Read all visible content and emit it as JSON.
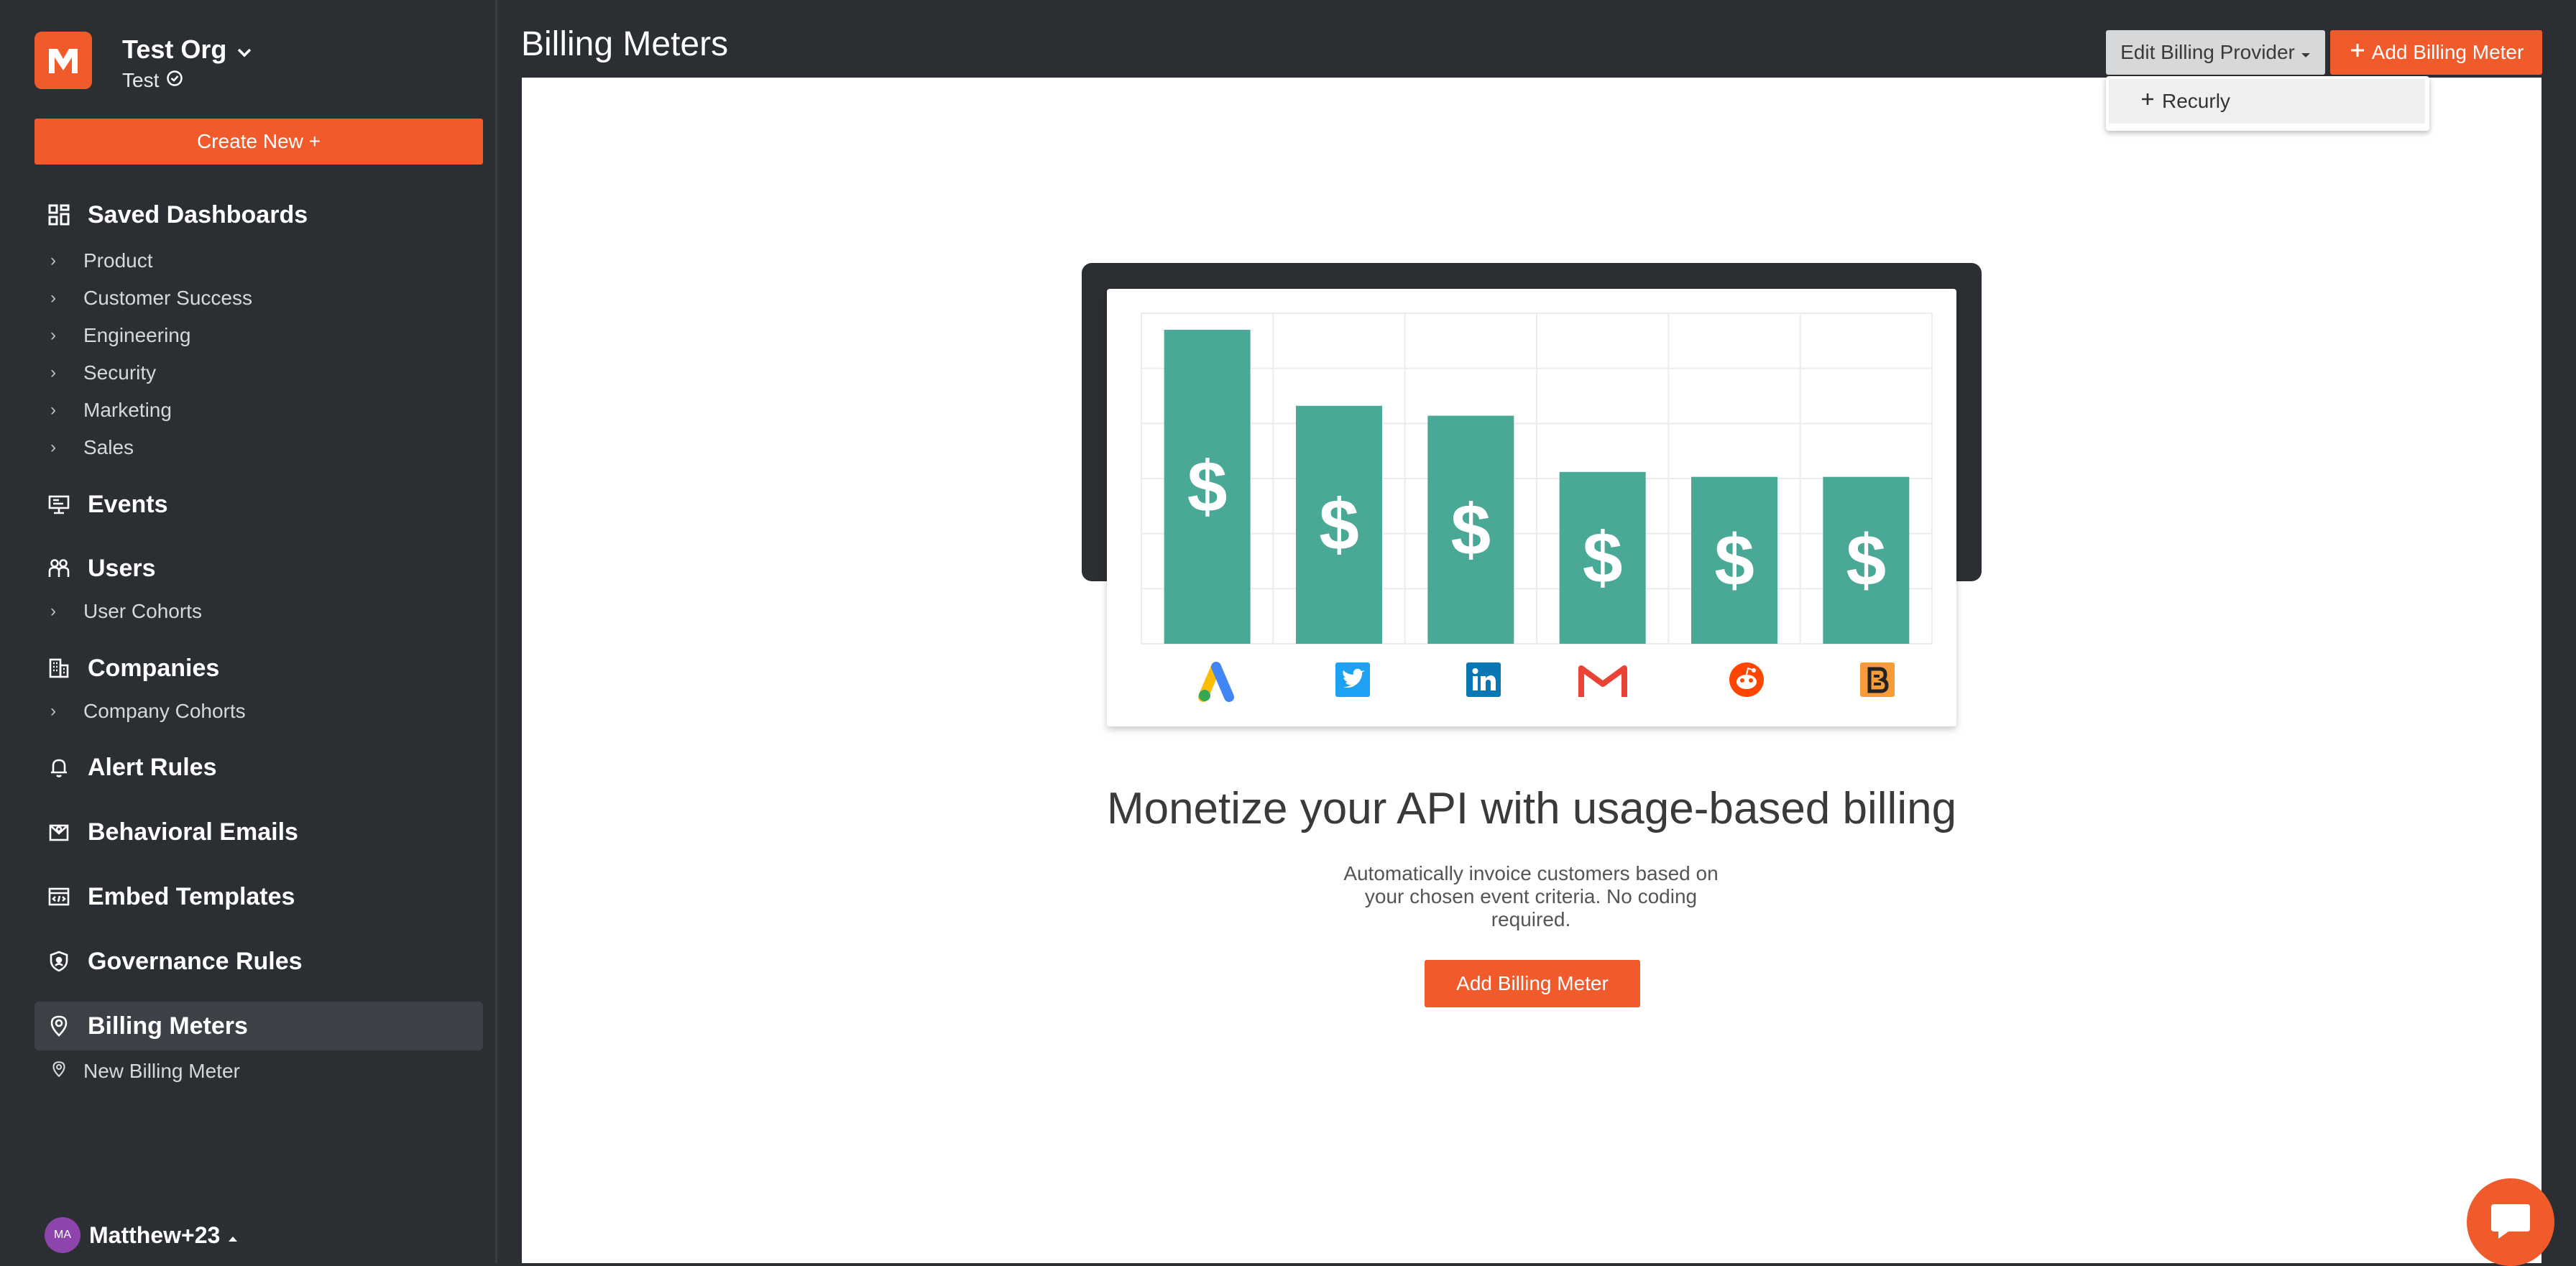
{
  "org": {
    "name": "Test Org",
    "env": "Test"
  },
  "sidebar": {
    "create_label": "Create New +",
    "saved_dashboards": {
      "label": "Saved Dashboards",
      "items": [
        "Product",
        "Customer Success",
        "Engineering",
        "Security",
        "Marketing",
        "Sales"
      ]
    },
    "events": {
      "label": "Events"
    },
    "users": {
      "label": "Users",
      "items": [
        "User Cohorts"
      ]
    },
    "companies": {
      "label": "Companies",
      "items": [
        "Company Cohorts"
      ]
    },
    "alert_rules": {
      "label": "Alert Rules"
    },
    "behavioral_emails": {
      "label": "Behavioral Emails"
    },
    "embed_templates": {
      "label": "Embed Templates"
    },
    "governance_rules": {
      "label": "Governance Rules"
    },
    "billing_meters": {
      "label": "Billing Meters",
      "items": [
        "New Billing Meter"
      ]
    },
    "user": {
      "initials": "MA",
      "name": "Matthew+23"
    }
  },
  "header": {
    "title": "Billing Meters",
    "edit_provider_label": "Edit Billing Provider",
    "add_meter_label": "Add Billing Meter"
  },
  "dropdown": {
    "items": [
      "Recurly"
    ]
  },
  "empty_state": {
    "headline": "Monetize your API with usage-based billing",
    "description": "Automatically invoice customers based on your chosen event criteria. No coding required.",
    "button_label": "Add Billing Meter",
    "bar_symbol": "$",
    "bar_levels": [
      0.95,
      0.72,
      0.69,
      0.52,
      0.505,
      0.505
    ],
    "logos": [
      "google-ads-icon",
      "twitter-icon",
      "linkedin-icon",
      "gmail-icon",
      "reddit-icon",
      "blogger-icon"
    ]
  },
  "colors": {
    "accent": "#f15a2b",
    "sidebar_bg": "#2b2e33",
    "bar": "#4aa896"
  }
}
